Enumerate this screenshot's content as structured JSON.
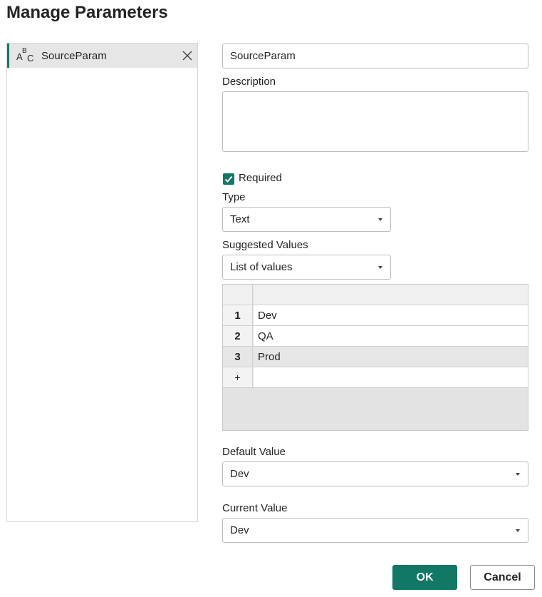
{
  "title": "Manage Parameters",
  "params": [
    {
      "label": "SourceParam",
      "type_icon": "abc-text-icon",
      "selected": true
    }
  ],
  "form": {
    "name_value": "SourceParam",
    "description_label": "Description",
    "description_value": "",
    "required_label": "Required",
    "required_checked": true,
    "type_label": "Type",
    "type_value": "Text",
    "suggested_label": "Suggested Values",
    "suggested_value": "List of values",
    "values_grid": {
      "rows": [
        {
          "num": "1",
          "value": "Dev"
        },
        {
          "num": "2",
          "value": "QA"
        },
        {
          "num": "3",
          "value": "Prod",
          "selected": true
        }
      ],
      "add_symbol": "+"
    },
    "default_label": "Default Value",
    "default_value": "Dev",
    "current_label": "Current Value",
    "current_value": "Dev"
  },
  "buttons": {
    "ok_label": "OK",
    "cancel_label": "Cancel"
  },
  "colors": {
    "accent": "#117865",
    "selected_bg": "#e6e6e6",
    "border": "#bdbdbd"
  }
}
